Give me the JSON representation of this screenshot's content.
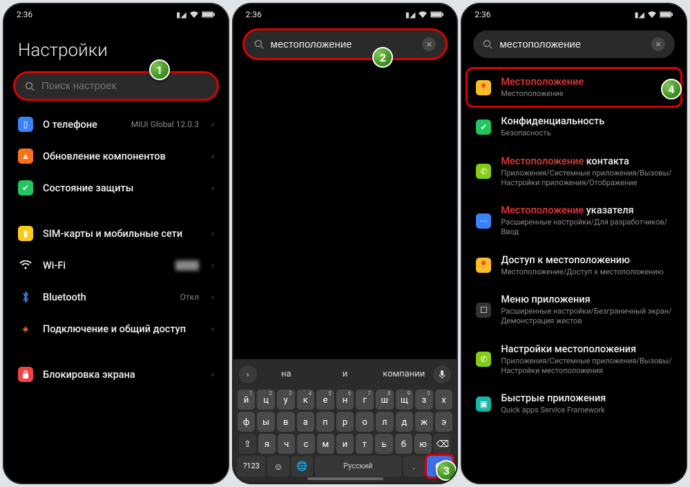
{
  "status": {
    "time": "2:36"
  },
  "badges": {
    "b1": "1",
    "b2": "2",
    "b3": "3",
    "b4": "4"
  },
  "panel1": {
    "title": "Настройки",
    "search_placeholder": "Поиск настроек",
    "items": [
      {
        "label": "О телефоне",
        "value": "MIUI Global 12.0.3"
      },
      {
        "label": "Обновление компонентов",
        "value": ""
      },
      {
        "label": "Состояние защиты",
        "value": ""
      }
    ],
    "items2": [
      {
        "label": "SIM-карты и мобильные сети",
        "value": ""
      },
      {
        "label": "Wi-Fi",
        "value": ""
      },
      {
        "label": "Bluetooth",
        "value": "Откл"
      },
      {
        "label": "Подключение и общий доступ",
        "value": ""
      }
    ],
    "items3": [
      {
        "label": "Блокировка экрана",
        "value": ""
      }
    ]
  },
  "panel2": {
    "search_value": "местоположение",
    "suggestions": {
      "s1": "на",
      "s2": "и",
      "s3": "компании"
    },
    "keyboard": {
      "row1": [
        "й",
        "ц",
        "у",
        "к",
        "е",
        "н",
        "г",
        "ш",
        "щ",
        "з",
        "х"
      ],
      "row1nums": [
        "1",
        "2",
        "3",
        "4",
        "5",
        "6",
        "7",
        "8",
        "9",
        "0",
        ""
      ],
      "row2": [
        "ф",
        "ы",
        "в",
        "а",
        "п",
        "р",
        "о",
        "л",
        "д",
        "ж",
        "э"
      ],
      "row3": [
        "я",
        "ч",
        "с",
        "м",
        "и",
        "т",
        "ь",
        "б",
        "ю"
      ],
      "bottom": {
        "symbols": "?123",
        "lang": "Русский"
      }
    }
  },
  "panel3": {
    "search_value": "местоположение",
    "results": [
      {
        "title_hl": "Местоположение",
        "title_rest": "",
        "sub": "Местоположение",
        "icon": "loc"
      },
      {
        "title_hl": "",
        "title_rest": "Конфиденциальность",
        "sub": "Безопасность",
        "icon": "green"
      },
      {
        "title_hl": "Местоположение",
        "title_rest": " контакта",
        "sub": "Приложения/Системные приложения/Вызовы/Настройки приложения/Отображение",
        "icon": "lime"
      },
      {
        "title_hl": "Местоположение",
        "title_rest": " указателя",
        "sub": "Расширенные настройки/Для разработчиков/Ввод",
        "icon": "blue"
      },
      {
        "title_hl": "",
        "title_rest": "Доступ к местоположению",
        "sub": "Местоположение/Доступ к местоположению",
        "icon": "loc"
      },
      {
        "title_hl": "",
        "title_rest": "Меню приложения",
        "sub": "Расширенные настройки/Безграничный экран/Демонстрация жестов",
        "icon": "dark"
      },
      {
        "title_hl": "",
        "title_rest": "Настройки местоположения",
        "sub": "Приложения/Системные приложения/Вызовы/Настройки местоположения",
        "icon": "lime"
      },
      {
        "title_hl": "",
        "title_rest": "Быстрые приложения",
        "sub": "Quick apps Service Framework",
        "icon": "teal"
      }
    ]
  }
}
